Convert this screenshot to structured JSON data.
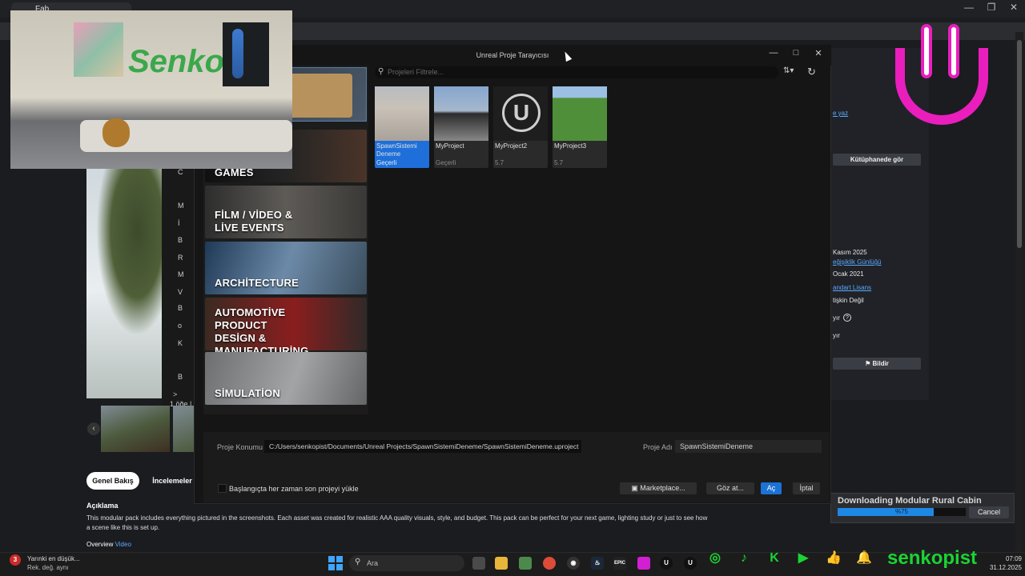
{
  "browser": {
    "tab_title": "Fab",
    "window_controls": [
      "—",
      "❐",
      "✕"
    ]
  },
  "explorer": {
    "items": [
      "C",
      "M",
      "İ",
      "B",
      "R",
      "M",
      "V",
      "B",
      "o",
      "K",
      "B",
      ">"
    ],
    "footer": "1 öğe |"
  },
  "fab_page": {
    "tabs": [
      "Genel Bakış",
      "İncelemeler"
    ],
    "description_heading": "Açıklama",
    "description": "This modular pack includes everything pictured in the screenshots. Each asset was created for realistic AAA quality visuals, style, and budget. This pack can be perfect for your next game, lighting study or just to see how a scene like this is set up.",
    "overview_label": "Overview",
    "overview_link": "Video"
  },
  "right_panel": {
    "write_link": "e yaz",
    "library_button": "Kütüphanede gör",
    "date1": "Kasım 2025",
    "changelog_link": "eğişiklik Günlüğü",
    "date2": "Ocak 2021",
    "license_link": "andart Lisans",
    "ai_label": "tişkin Değil",
    "flag1": "yır",
    "flag2": "yır",
    "report_button": "Bildir"
  },
  "download": {
    "title": "Downloading Modular Rural Cabin",
    "percent_text": "%75",
    "progress": 0.75,
    "cancel": "Cancel"
  },
  "ue": {
    "title": "Unreal Proje Tarayıcısı",
    "search_placeholder": "Projeleri Filtrele...",
    "categories": [
      {
        "label": "GAMES"
      },
      {
        "label": "FİLM / VİDEO & LİVE EVENTS"
      },
      {
        "label": "ARCHİTECTURE"
      },
      {
        "label": "AUTOMOTİVE PRODUCT DESİGN & MANUFACTURİNG"
      },
      {
        "label": "SİMULATİON"
      }
    ],
    "projects": [
      {
        "name": "SpawnSistemi Deneme",
        "version": "Geçerli",
        "selected": true
      },
      {
        "name": "MyProject",
        "version": "Geçerli",
        "selected": false
      },
      {
        "name": "MyProject2",
        "version": "5.7",
        "selected": false
      },
      {
        "name": "MyProject3",
        "version": "5.7",
        "selected": false
      }
    ],
    "location_label": "Proje Konumu",
    "location_value": "C:/Users/senkopist/Documents/Unreal Projects/SpawnSistemiDeneme/SpawnSistemiDeneme.uproject",
    "name_label": "Proje Adı",
    "name_value": "SpawnSistemiDeneme",
    "startup_checkbox": "Başlangıçta her zaman son projeyi yükle",
    "buttons": {
      "marketplace": "Marketplace...",
      "browse": "Göz at...",
      "open": "Aç",
      "cancel": "İptal"
    }
  },
  "taskbar": {
    "weather_badge": "3",
    "weather_line1": "Yarınki en düşük...",
    "weather_line2": "Rek. değ. aynı",
    "search_placeholder": "Ara",
    "social_handle": "senkopist",
    "time": "07:09",
    "date": "31.12.2025"
  }
}
